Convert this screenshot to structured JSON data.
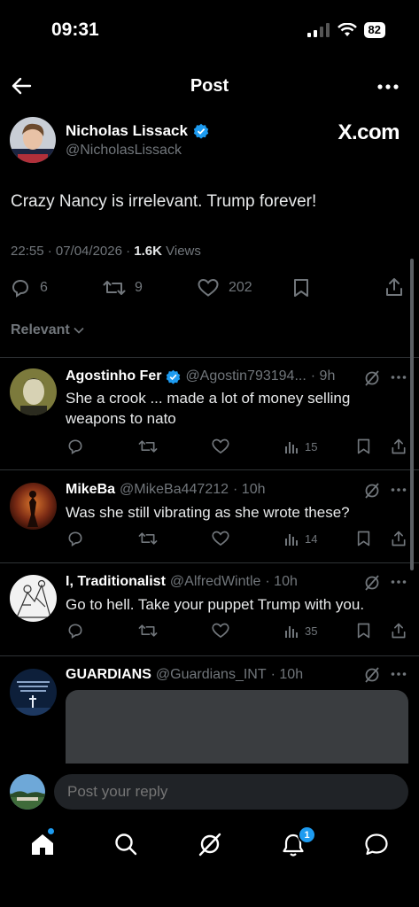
{
  "status_bar": {
    "time": "09:31",
    "battery": "82"
  },
  "header": {
    "title": "Post"
  },
  "post": {
    "author_name": "Nicholas Lissack",
    "author_handle": "@NicholasLissack",
    "watermark": "X.com",
    "text": "Crazy Nancy is irrelevant. Trump forever!",
    "timestamp": "22:55 · 07/04/2026 · ",
    "views_count": "1.6K",
    "views_label": " Views",
    "replies": "6",
    "reposts": "9",
    "likes": "202"
  },
  "sort": {
    "label": "Relevant"
  },
  "replies": [
    {
      "name": "Agostinho Fer",
      "handle": "@Agostin793194...",
      "time": "· 9h",
      "text": "She a crook ... made a lot of money selling weapons to nato",
      "views": "15"
    },
    {
      "name": "MikeBa",
      "handle": "@MikeBa447212",
      "time": "· 10h",
      "text": "Was she still vibrating as she wrote these?",
      "views": "14"
    },
    {
      "name": "I, Traditionalist",
      "handle": "@AlfredWintle",
      "time": "· 10h",
      "text": "Go to hell. Take your puppet Trump with you.",
      "views": "35"
    },
    {
      "name": "GUARDIANS",
      "handle": "@Guardians_INT",
      "time": "· 10h"
    }
  ],
  "composer": {
    "placeholder": "Post your reply"
  },
  "tabbar": {
    "notifications_badge": "1"
  },
  "colors": {
    "accent": "#1d9bf0",
    "background": "#000000",
    "muted": "#71767b"
  }
}
